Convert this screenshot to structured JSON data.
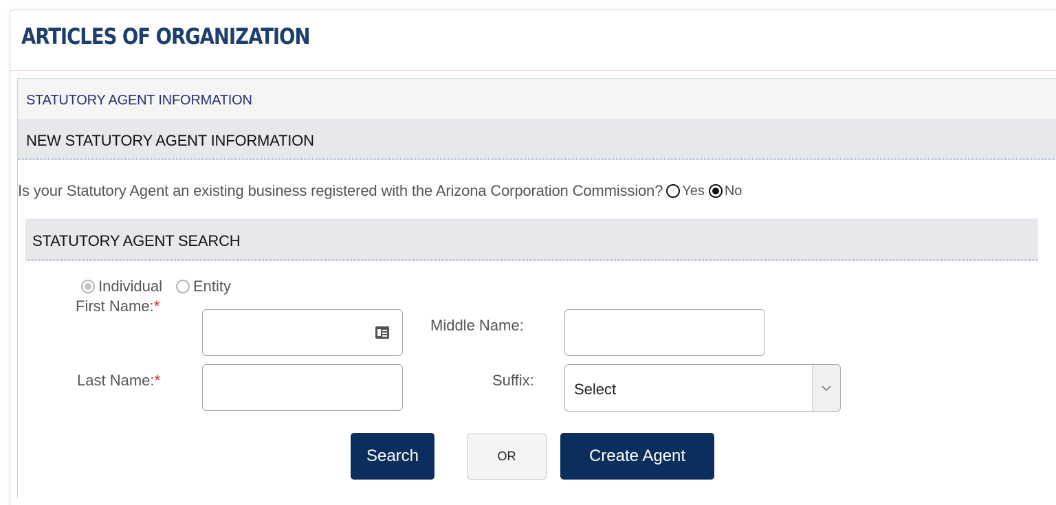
{
  "page": {
    "title": "ARTICLES OF ORGANIZATION"
  },
  "section": {
    "header": "STATUTORY AGENT INFORMATION",
    "subheader": "NEW STATUTORY AGENT INFORMATION",
    "question": {
      "text": "Is your Statutory Agent an existing business registered with the Arizona Corporation Commission?",
      "options": [
        {
          "label": "Yes",
          "selected": false
        },
        {
          "label": "No",
          "selected": true
        }
      ]
    }
  },
  "search": {
    "header": "STATUTORY AGENT SEARCH",
    "type_options": [
      {
        "label": "Individual",
        "selected": true,
        "disabled": true
      },
      {
        "label": "Entity",
        "selected": false,
        "disabled": true
      }
    ],
    "fields": {
      "first_name": {
        "label": "First Name:",
        "required": "*",
        "value": ""
      },
      "middle_name": {
        "label": "Middle Name:",
        "value": ""
      },
      "last_name": {
        "label": "Last Name:",
        "required": "*",
        "value": ""
      },
      "suffix": {
        "label": "Suffix:",
        "selected": "Select"
      }
    },
    "buttons": {
      "search": "Search",
      "or": "OR",
      "create_agent": "Create Agent"
    }
  },
  "colors": {
    "title": "#1c3f6e",
    "primary_button": "#0b2e5c",
    "required": "#e0201b",
    "section_header_text": "#27306b"
  },
  "icons": {
    "first_name_field": "contact-card-icon",
    "suffix_dropdown": "chevron-down-icon"
  }
}
